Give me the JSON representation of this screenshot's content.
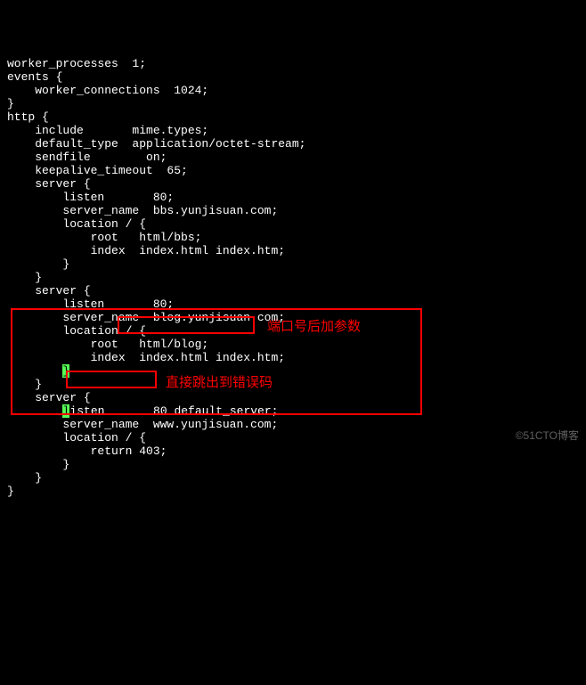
{
  "config": {
    "lines": [
      "worker_processes  1;",
      "events {",
      "    worker_connections  1024;",
      "}",
      "http {",
      "    include       mime.types;",
      "    default_type  application/octet-stream;",
      "    sendfile        on;",
      "    keepalive_timeout  65;",
      "    server {",
      "        listen       80;",
      "        server_name  bbs.yunjisuan.com;",
      "        location / {",
      "            root   html/bbs;",
      "            index  index.html index.htm;",
      "        }",
      "    }",
      "    server {",
      "        listen       80;",
      "        server_name  blog.yunjisuan.com;",
      "        location / {",
      "            root   html/blog;",
      "            index  index.html index.htm;",
      "        }",
      "    }",
      "    server {",
      "        listen       80 default_server;",
      "        server_name  www.yunjisuan.com;",
      "        location / {",
      "            return 403;",
      "        }",
      "    }",
      "}"
    ]
  },
  "cursor_lines": [
    23,
    26
  ],
  "annotations": {
    "annotation1": "端口号后加参数",
    "annotation2": "直接跳出到错误码"
  },
  "watermark": "©51CTO博客"
}
